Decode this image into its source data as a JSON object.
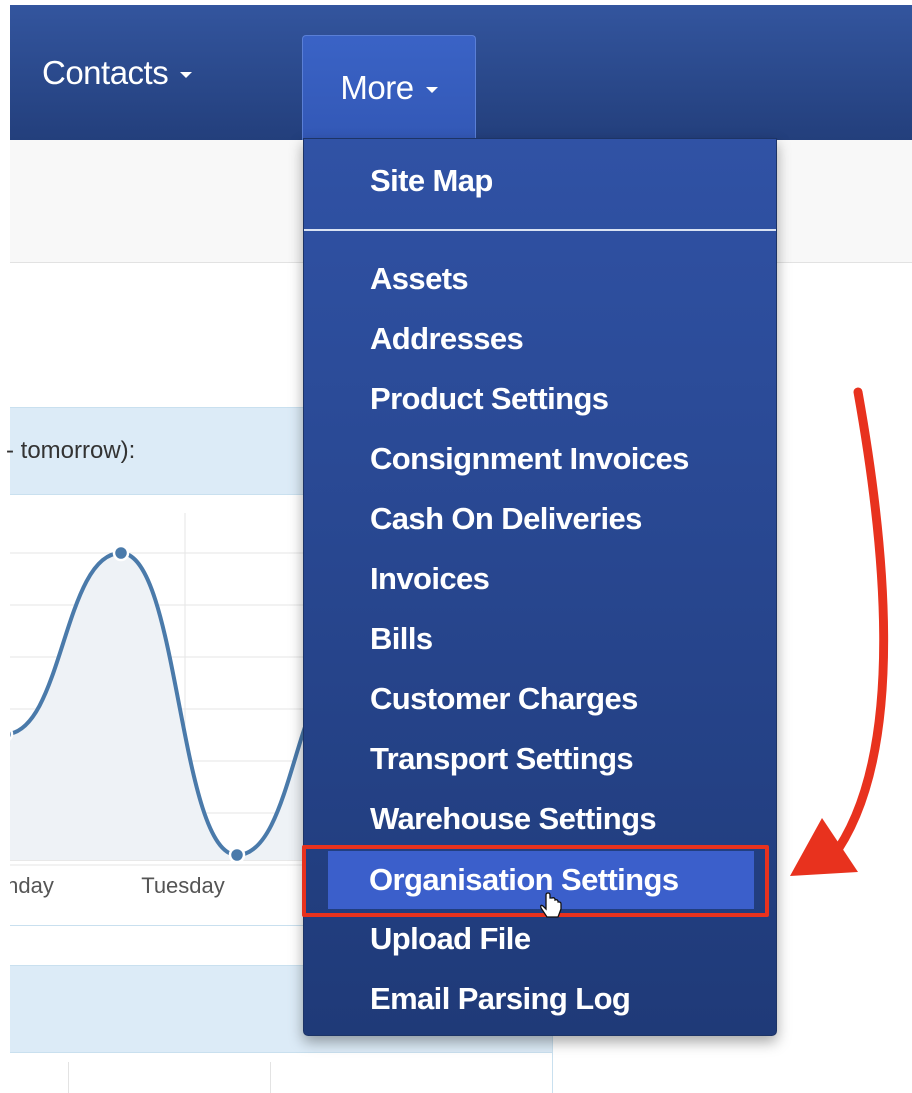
{
  "navbar": {
    "contacts_label": "Contacts",
    "more_label": "More",
    "bg_color": "#2a4a8f"
  },
  "panel": {
    "heading": "- tomorrow):",
    "chart_data": {
      "type": "line",
      "categories": [
        "nday",
        "Tuesday"
      ],
      "series": [
        {
          "values": [
            2.2,
            5.5,
            0.0,
            3.5
          ]
        }
      ],
      "color": "#4a7aaa",
      "grid": true
    }
  },
  "dropdown": {
    "items": [
      {
        "label": "Site Map"
      },
      {
        "label": "Assets"
      },
      {
        "label": "Addresses"
      },
      {
        "label": "Product Settings"
      },
      {
        "label": "Consignment Invoices"
      },
      {
        "label": "Cash On Deliveries"
      },
      {
        "label": "Invoices"
      },
      {
        "label": "Bills"
      },
      {
        "label": "Customer Charges"
      },
      {
        "label": "Transport Settings"
      },
      {
        "label": "Warehouse Settings"
      },
      {
        "label": "Organisation Settings"
      },
      {
        "label": "Upload File"
      },
      {
        "label": "Email Parsing Log"
      }
    ],
    "active_item": "Organisation Settings"
  },
  "annotation": {
    "color": "#e8321e"
  }
}
